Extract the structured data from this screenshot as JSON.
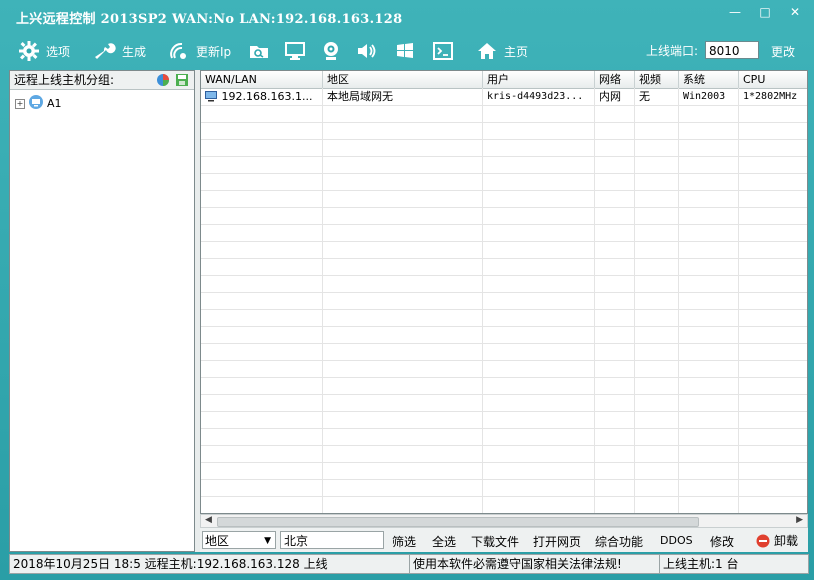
{
  "window": {
    "title": "上兴远程控制 2013SP2 WAN:No LAN:192.168.163.128",
    "min": "—",
    "max": "□",
    "close": "✕"
  },
  "toolbar": {
    "options_label": "选项",
    "generate_label": "生成",
    "update_ip_label": "更新Ip",
    "home_label": "主页",
    "port_label": "上线端口:",
    "port_value": "8010",
    "change_label": "更改"
  },
  "sidebar": {
    "header": "远程上线主机分组:",
    "groups": [
      {
        "expander": "+",
        "name": "A1"
      }
    ]
  },
  "table": {
    "columns": [
      "WAN/LAN",
      "地区",
      "用户",
      "网络",
      "视频",
      "系统",
      "CPU"
    ],
    "rows": [
      [
        "192.168.163.1...",
        "本地局域网无",
        "kris-d4493d23...",
        "内网",
        "无",
        "Win2003",
        "1*2802MHz"
      ]
    ]
  },
  "bottom": {
    "region_select": "地区",
    "city_input": "北京",
    "filter": "筛选",
    "select_all": "全选",
    "download": "下载文件",
    "open_web": "打开网页",
    "combo": "综合功能",
    "ddos": "DDOS",
    "modify": "修改",
    "uninstall": "卸载"
  },
  "status": {
    "time": "2018年10月25日 18:5",
    "host": "远程主机:192.168.163.128 上线",
    "notice": "使用本软件必需遵守国家相关法律法规!",
    "online": "上线主机:1 台"
  }
}
